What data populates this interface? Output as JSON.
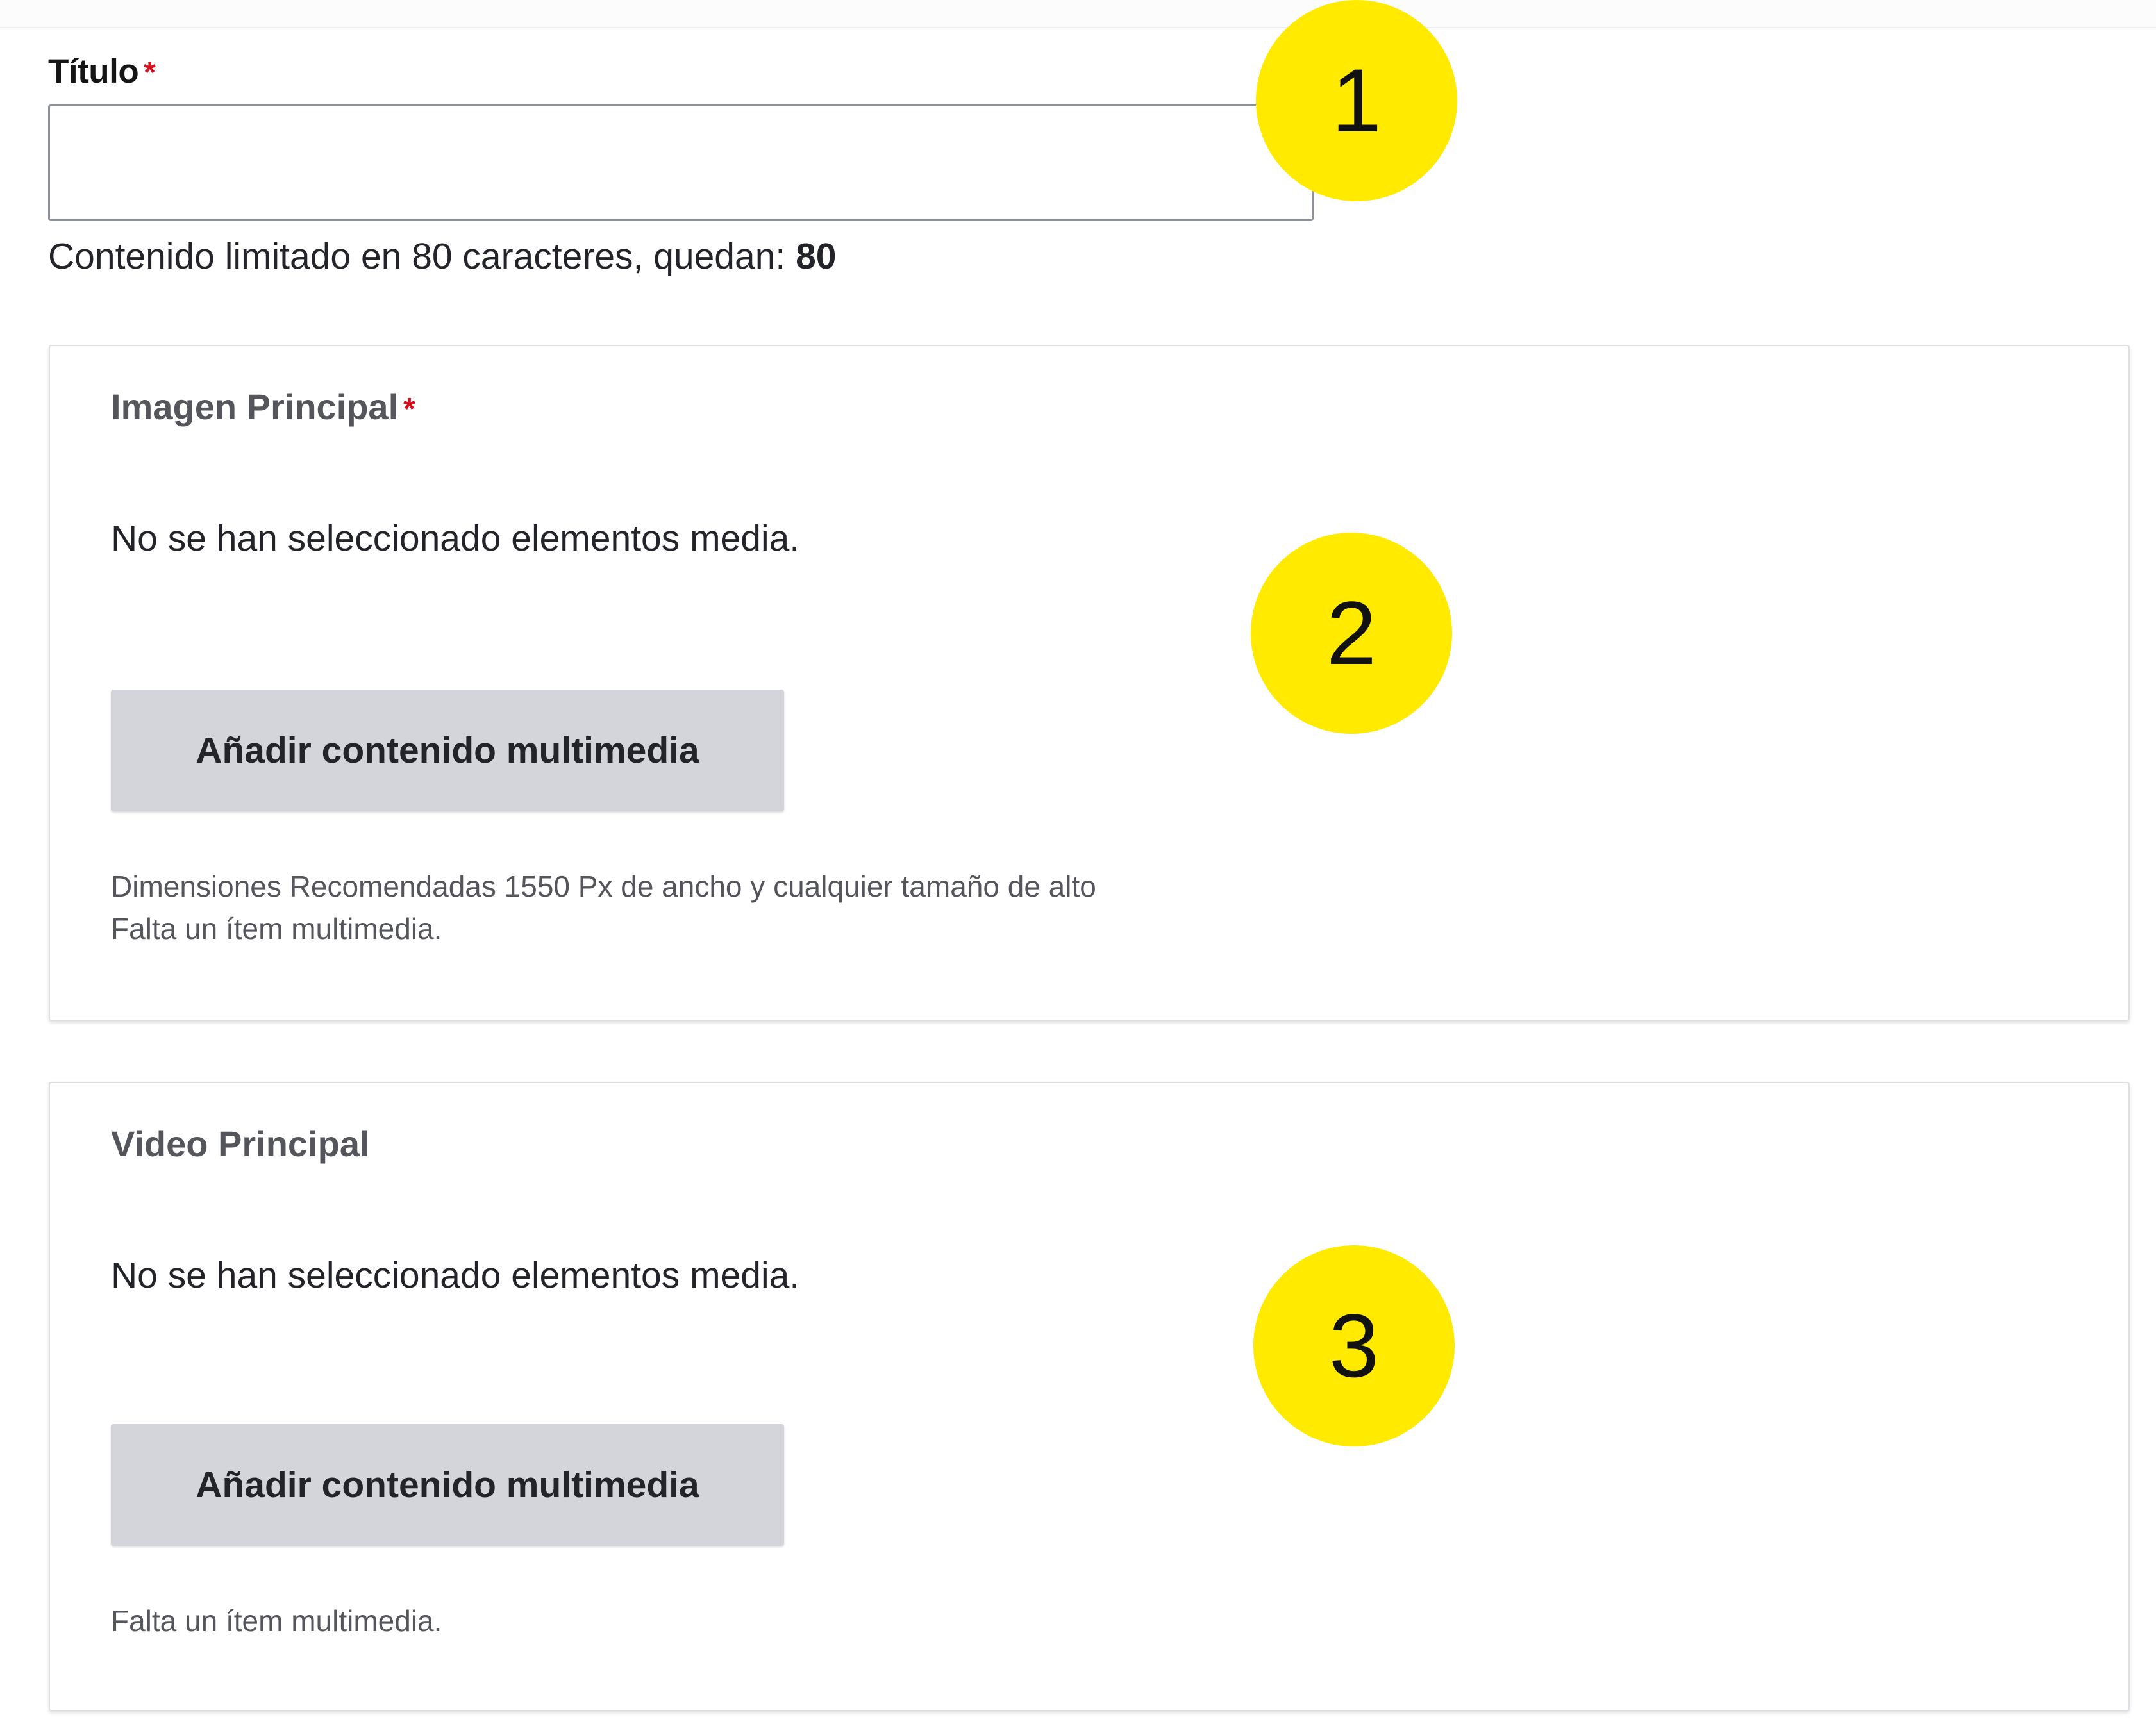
{
  "title_field": {
    "label": "Título",
    "required_mark": "*",
    "value": "",
    "char_limit_text": "Contenido limitado en 80 caracteres, quedan: ",
    "remaining": "80"
  },
  "main_image": {
    "title": "Imagen Principal",
    "required_mark": "*",
    "empty_text": "No se han seleccionado elementos media.",
    "button_label": "Añadir contenido multimedia",
    "description": "Dimensiones Recomendadas 1550 Px de ancho y cualquier tamaño de alto",
    "missing_text": "Falta un ítem multimedia."
  },
  "main_video": {
    "title": "Video Principal",
    "empty_text": "No se han seleccionado elementos media.",
    "button_label": "Añadir contenido multimedia",
    "missing_text": "Falta un ítem multimedia."
  },
  "markers": [
    "1",
    "2",
    "3"
  ],
  "colors": {
    "marker": "#ffea00",
    "required": "#d2101e",
    "button_bg": "#d4d5da"
  }
}
